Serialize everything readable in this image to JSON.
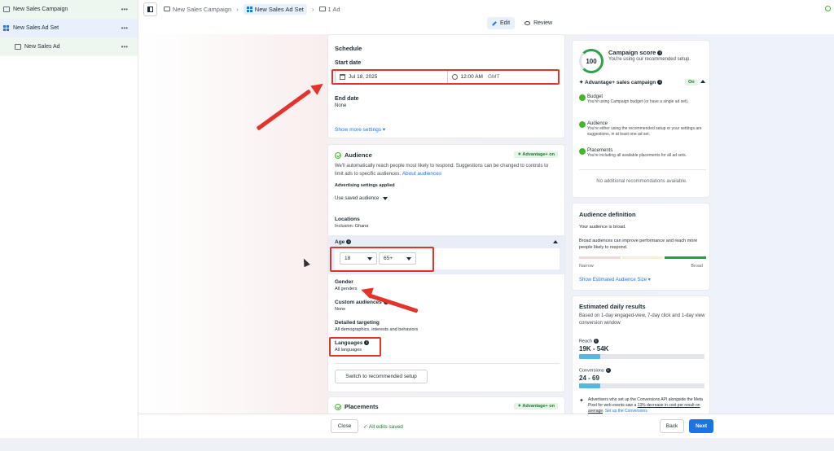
{
  "tree": {
    "campaign": "New Sales Campaign",
    "adset": "New Sales Ad Set",
    "ad": "New Sales Ad",
    "more": "•••"
  },
  "breadcrumb": {
    "campaign": "New Sales Campaign",
    "adset": "New Sales Ad Set",
    "ad": "1 Ad",
    "sep": "›"
  },
  "tabs": {
    "edit": "Edit",
    "review": "Review"
  },
  "schedule": {
    "title": "Schedule",
    "start_label": "Start date",
    "start_date": "Jul 18, 2025",
    "start_time": "12:00 AM",
    "timezone": "GMT",
    "end_label": "End date",
    "end_value": "None",
    "show_more": "Show more settings ▾"
  },
  "audience": {
    "title": "Audience",
    "badge": "✦ Advantage+ on",
    "desc": "We'll automatically reach people most likely to respond. Suggestions can be changed to controls to limit ads to specific audiences.",
    "desc_link": "About audiences",
    "adv_settings": "Advertising settings applied",
    "saved_audience": "Use saved audience",
    "locations_label": "Locations",
    "locations_value": "Inclusion: Ghana",
    "age_label": "Age",
    "age_min": "18",
    "age_max": "65+",
    "gender_label": "Gender",
    "gender_value": "All genders",
    "custom_label": "Custom audiences",
    "custom_value": "None",
    "detailed_label": "Detailed targeting",
    "detailed_value": "All demographics, interests and behaviors",
    "languages_label": "Languages",
    "languages_value": "All languages",
    "switch_btn": "Switch to recommended setup"
  },
  "placements": {
    "title": "Placements",
    "badge": "✦ Advantage+ on"
  },
  "score": {
    "value": "100",
    "title": "Campaign score",
    "subtitle": "You're using our recommended setup.",
    "advantage_label": "✦ Advantage+ sales campaign",
    "advantage_state": "On",
    "items": [
      {
        "title": "Budget",
        "text": "You're using Campaign budget (or have a single ad set)."
      },
      {
        "title": "Audience",
        "text": "You're either using the recommended setup or your settings are suggestions, in at least one ad set."
      },
      {
        "title": "Placements",
        "text": "You're including all available placements for all ad sets."
      }
    ],
    "no_recs": "No additional recommendations available."
  },
  "audience_def": {
    "title": "Audience definition",
    "line1": "Your audience is broad.",
    "line2": "Broad audiences can improve performance and reach more people likely to respond.",
    "narrow": "Narrow",
    "broad": "Broad",
    "level": 0.72,
    "show_size": "Show Estimated Audience Size ▾"
  },
  "estimated": {
    "title": "Estimated daily results",
    "desc": "Based on 1-day engaged-view, 7-day click and 1-day view conversion window",
    "reach_label": "Reach",
    "reach_value": "19K - 54K",
    "reach_fill": 0.17,
    "conv_label": "Conversions",
    "conv_value": "24 - 69",
    "conv_fill": 0.17,
    "note_a": "Advertisers who set up the Conversions API alongside the Meta Pixel for web events saw a",
    "note_link": "13% decrease in cost per result on average",
    "note_b": ". Set up the Conversions"
  },
  "footer": {
    "close": "Close",
    "saved": "✓ All edits saved",
    "back": "Back",
    "next": "Next"
  },
  "colors": {
    "accent": "#1b74e4",
    "green": "#42b72a",
    "annotation_red": "#e3332b"
  }
}
